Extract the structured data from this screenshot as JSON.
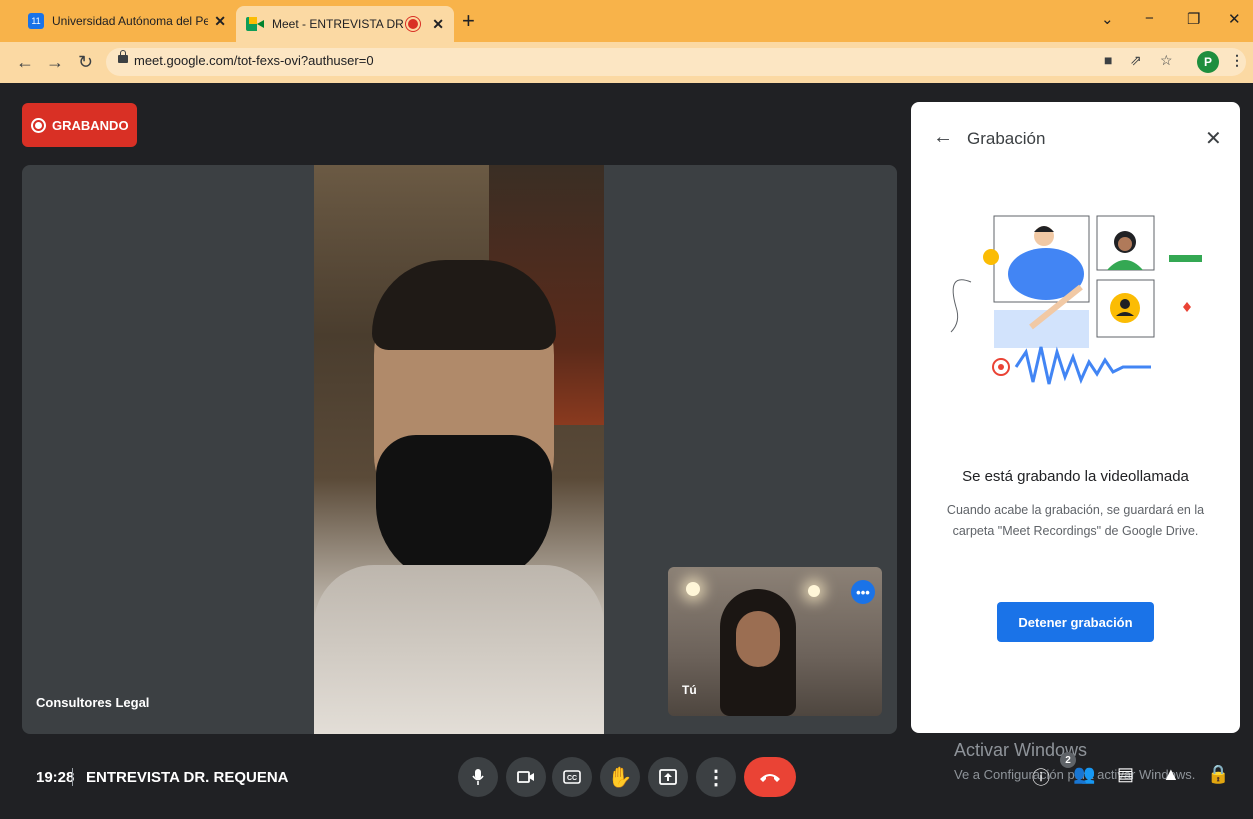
{
  "browser": {
    "tabs": [
      {
        "title": "Universidad Autónoma del Perú",
        "favicon": "calendar-icon",
        "favicon_text": "11"
      },
      {
        "title": "Meet - ENTREVISTA DR. REQ",
        "favicon": "meet-icon",
        "recording": true
      }
    ],
    "url": "meet.google.com/tot-fexs-ovi?authuser=0",
    "profile_initial": "P"
  },
  "recording_badge": {
    "label": "GRABANDO",
    "color": "#d93025"
  },
  "participants": {
    "main_name": "Consultores Legal",
    "self_name": "Tú"
  },
  "panel": {
    "title": "Grabación",
    "heading": "Se está grabando la videollamada",
    "description": "Cuando acabe la grabación, se guardará en la carpeta \"Meet Recordings\" de Google Drive.",
    "stop_button": "Detener grabación",
    "accent": "#1a73e8"
  },
  "toolbar": {
    "time": "19:28",
    "meeting_name": "ENTREVISTA DR. REQUENA",
    "participants_count": "2",
    "hangup_color": "#ea4335"
  },
  "watermark": {
    "line1": "Activar Windows",
    "line2": "Ve a Configuración para activar Windows."
  }
}
